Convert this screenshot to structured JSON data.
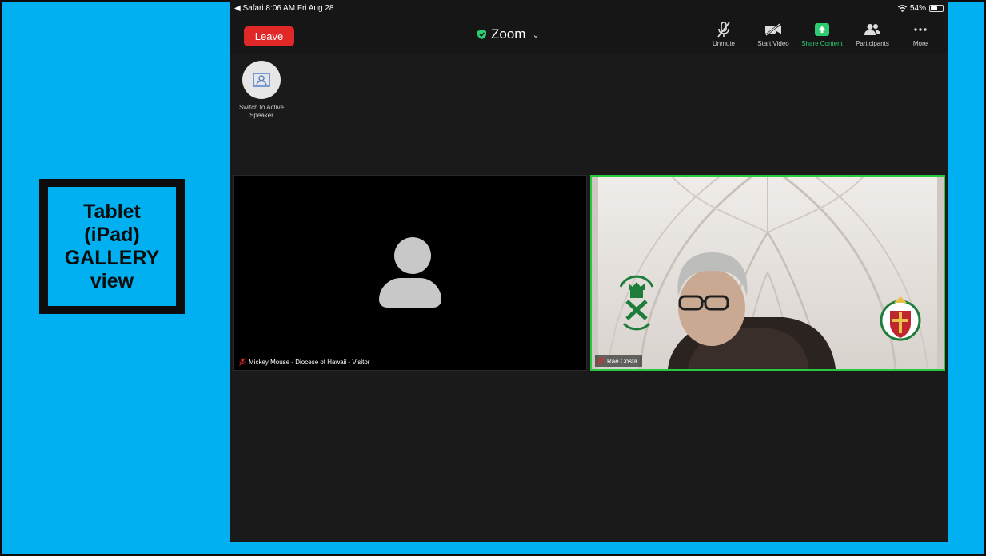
{
  "slide": {
    "label_lines": [
      "Tablet",
      "(iPad)",
      "GALLERY",
      "view"
    ]
  },
  "statusbar": {
    "left": "◀ Safari  8:06 AM  Fri Aug 28",
    "battery": "54%"
  },
  "toolbar": {
    "leave_label": "Leave",
    "title": "Zoom",
    "items": [
      {
        "label": "Unmute",
        "icon": "mic-muted-icon"
      },
      {
        "label": "Start Video",
        "icon": "video-off-icon"
      },
      {
        "label": "Share Content",
        "icon": "share-icon"
      },
      {
        "label": "Participants",
        "icon": "participants-icon"
      },
      {
        "label": "More",
        "icon": "more-icon"
      }
    ]
  },
  "active_speaker": {
    "label": "Switch to Active Speaker"
  },
  "tiles": [
    {
      "name": "Mickey Mouse - Diocese of Hawaii - Visitor",
      "video": false
    },
    {
      "name": "Rae Costa",
      "video": true
    }
  ],
  "colors": {
    "slide_bg": "#00b0f0",
    "leave": "#e02828",
    "share": "#2ecc71",
    "active_border": "#27c93f"
  }
}
